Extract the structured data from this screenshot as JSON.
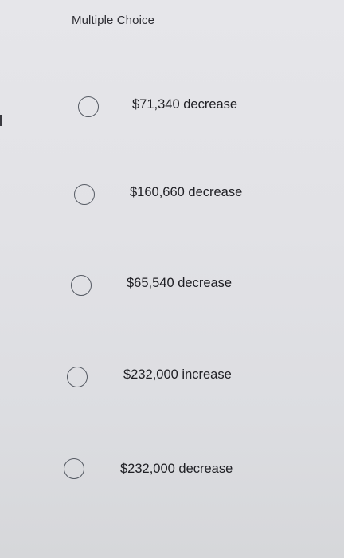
{
  "question": {
    "type_label": "Multiple Choice"
  },
  "options": [
    {
      "label": "$71,340 decrease",
      "selected": false
    },
    {
      "label": "$160,660 decrease",
      "selected": false
    },
    {
      "label": "$65,540 decrease",
      "selected": false
    },
    {
      "label": "$232,000 increase",
      "selected": false
    },
    {
      "label": "$232,000 decrease",
      "selected": false
    }
  ],
  "colors": {
    "background": "#e2e2e6",
    "text": "#1f1f24",
    "radio_border": "#555a63"
  }
}
